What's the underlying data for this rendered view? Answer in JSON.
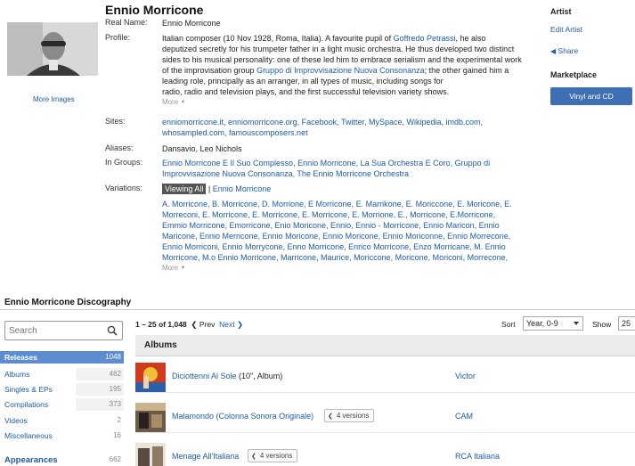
{
  "artist": {
    "name": "Ennio Morricone",
    "more_images": "More Images",
    "real_name_label": "Real Name:",
    "real_name": "Ennio Morricone",
    "profile_label": "Profile:",
    "profile_lines": [
      [
        "Italian composer (10 Nov 1928, Roma, Italia). A favourite pupil of ",
        "Goffredo Petrassi",
        ", he also"
      ],
      [
        "deputized secretly for his trumpeter father in a light music orchestra. He thus developed two distinct",
        "",
        ""
      ],
      [
        "sides to his musical personality: one of these led him to embrace serialism and the experimental work",
        "",
        ""
      ],
      [
        "of the improvisation group ",
        "Gruppo di Improvvisazione Nuova Consonanza",
        "; the other gained him a"
      ],
      [
        "leading role, principally as an arranger, in all types of music, including songs for",
        "",
        ""
      ],
      [
        "radio, radio and television plays, and the first successful television variety shows.",
        "",
        ""
      ]
    ],
    "more": "More",
    "sites_label": "Sites:",
    "sites_lines": [
      "enniomorricone.it, enniomorricone.org, Facebook, Twitter, MySpace, Wikipedia, imdb.com,",
      "whosampled.com, famouscomposers.net"
    ],
    "aliases_label": "Aliases:",
    "aliases": "Dansavio, Leo Nichols",
    "groups_label": "In Groups:",
    "groups_lines": [
      "Ennio Morricone E Il Suo Complesso, Ennio Morricone, La Sua Orchestra E Coro, Gruppo di",
      "Improvvisazione Nuova Consonanza, The Ennio Morricone Orchestra"
    ],
    "variations_label": "Variations:",
    "viewing_all": "Viewing All",
    "separator": "|",
    "variation_primary": "Ennio Morricone",
    "variations_lines": [
      "A. Morricone, B. Morricone, D. Morrione, E Morricone, E. Marrikone, E. Moriccone, E. Moricone, E.",
      "Morreconi, E. Morricone, E. Morricone, E. Morricone, E. Morrione, E., Morricone, E.Morricone,",
      "Emmio Morricone, Emorricone, Enio Moricone, Ennio, Ennio - Morricone, Ennio Maricon, Ennio",
      "Maricone, Ennio Merricone, Ennio Moricone, Ennio Moricone, Ennio Moriconne, Ennio Morrecone,",
      "Ennio Morriconi, Ennio Morrycone, Enno Morricone, Enrico Morricone, Enzo Morricane, M. Ennio",
      "Morricone, M.o Ennio Morricone, Marricone, Maurice, Moriccone, Moricone, Moriconi, Morrecone,"
    ]
  },
  "sidebar": {
    "artist_heading": "Artist",
    "edit_artist": "Edit Artist",
    "share": "Share",
    "marketplace_heading": "Marketplace",
    "vinyl_button": "Vinyl and CD"
  },
  "discography": {
    "title": "Ennio Morricone Discography",
    "search_placeholder": "Search",
    "filters": [
      {
        "label": "Releases",
        "count": "1048",
        "kind": "active"
      },
      {
        "label": "Albums",
        "count": "462",
        "kind": "sub"
      },
      {
        "label": "Singles & EPs",
        "count": "195",
        "kind": "sub"
      },
      {
        "label": "Compilations",
        "count": "373",
        "kind": "sub"
      },
      {
        "label": "Videos",
        "count": "2",
        "kind": "sub"
      },
      {
        "label": "Miscellaneous",
        "count": "16",
        "kind": "sub"
      },
      {
        "label": "Appearances",
        "count": "662",
        "kind": "head"
      }
    ],
    "pagination": {
      "range": "1 – 25 of 1,048",
      "prev": "Prev",
      "next": "Next"
    },
    "sort_label": "Sort",
    "sort_value": "Year, 0-9",
    "show_label": "Show",
    "show_value": "25",
    "section": "Albums",
    "releases": [
      {
        "title": "Diciottenni Al Sole",
        "format": " (10\", Album)",
        "versions": "",
        "label": "Victor"
      },
      {
        "title": "Malamondo (Colonna Sonora Originale)",
        "format": "",
        "versions": "4 versions",
        "label": "CAM"
      },
      {
        "title": "Menage All'Italiana",
        "format": "",
        "versions": "4 versions",
        "label": "RCA Italiana"
      }
    ]
  },
  "colors": {
    "link": "#1f5ba6",
    "accent": "#5b8dd0",
    "button": "#3f6fb3"
  }
}
